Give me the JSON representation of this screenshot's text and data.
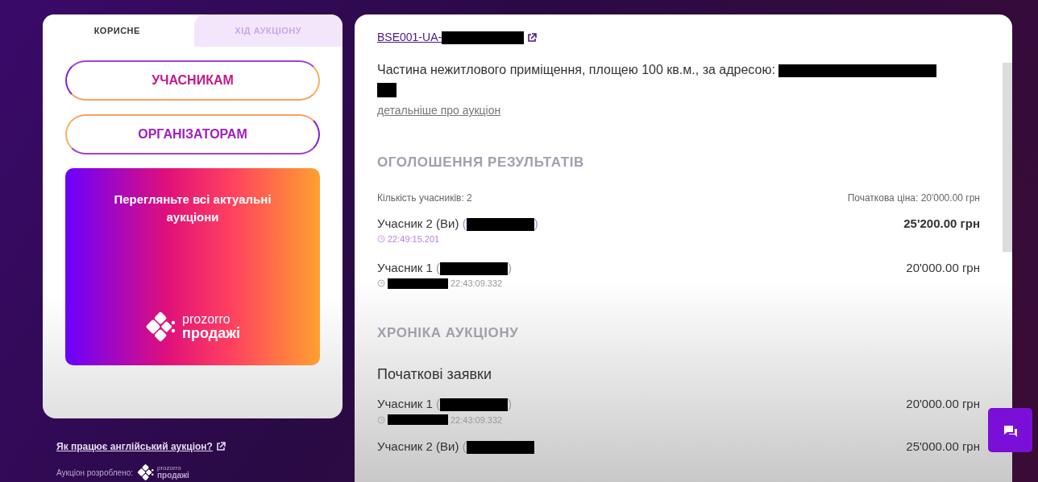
{
  "tabs": [
    {
      "label": "КОРИСНЕ",
      "selected": true
    },
    {
      "label": "ХІД АУКЦІОНУ",
      "selected": false
    }
  ],
  "role_buttons": [
    {
      "label": "УЧАСНИКАМ",
      "kind": "purple-first"
    },
    {
      "label": "ОРГАНІЗАТОРАМ",
      "kind": "orange-first"
    }
  ],
  "promo": {
    "text": "Перегляньте всі актуальні аукціони",
    "logo_top": "prozorro",
    "logo_bottom": "продажі"
  },
  "help_link": "Як працює англійський аукціон?",
  "footer": {
    "label": "Аукціон розроблено:",
    "logo_top": "prozorro",
    "logo_bottom": "продажі"
  },
  "auction": {
    "id": "BSE001-UA-",
    "id_redacted": true,
    "description": "Частина нежитлового приміщення, площею 100 кв.м., за адресою:",
    "description_redacted": true,
    "details_link": "детальніше про аукціон"
  },
  "results": {
    "title": "ОГОЛОШЕННЯ РЕЗУЛЬТАТІВ",
    "participants": "Кількість учасників: 2",
    "start_price": "Початкова ціна: 20'000.00 грн",
    "bids": [
      {
        "name": "Учасник 2 (Ви)",
        "you": true,
        "paren_open": "(",
        "paren_close": ")",
        "name_redacted": true,
        "date_redacted": false,
        "time": "22:49:15.201",
        "amount": "25'200.00 грн",
        "winner": true
      },
      {
        "name": "Учасник 1",
        "you": false,
        "paren_open": "(",
        "paren_close": ")",
        "name_redacted": true,
        "date_redacted": true,
        "time": "22:43:09.332",
        "amount": "20'000.00 грн",
        "winner": false
      }
    ]
  },
  "chronicle": {
    "title": "ХРОНІКА АУКЦІОНУ",
    "subtitle": "Початкові заявки",
    "bids": [
      {
        "name": "Учасник 1",
        "you": false,
        "paren_open": "(",
        "paren_close": ")",
        "name_redacted": true,
        "date_redacted": true,
        "time": "22:43:09.332",
        "amount": "20'000.00 грн",
        "winner": false
      },
      {
        "name": "Учасник 2 (Ви)",
        "you": false,
        "paren_open": "(",
        "name_redacted": true,
        "amount": "25'000.00 грн",
        "winner": false
      }
    ]
  }
}
